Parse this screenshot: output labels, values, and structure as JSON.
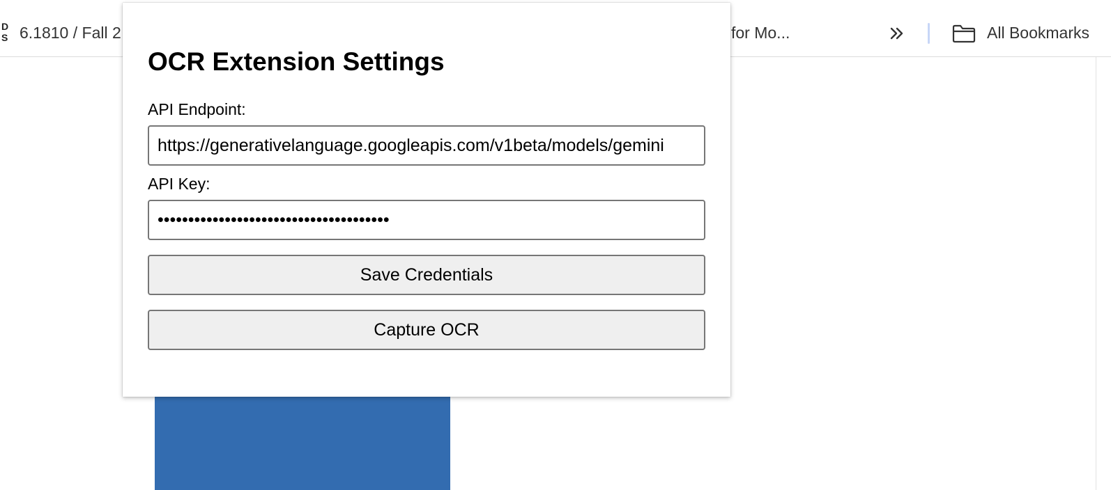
{
  "bookmarks_bar": {
    "favicon_letters": [
      "D",
      "S"
    ],
    "bookmark_1_label": "6.1810 / Fall 2",
    "bookmark_2_label": "for Mo...",
    "overflow_icon": "double-chevron-right-icon",
    "folder_icon": "folder-icon",
    "all_bookmarks_label": "All Bookmarks",
    "accent_color": "#c7d6f7"
  },
  "page": {
    "block_color": "#336cb0"
  },
  "popup": {
    "title": "OCR Extension Settings",
    "endpoint_label": "API Endpoint:",
    "endpoint_value": "https://generativelanguage.googleapis.com/v1beta/models/gemini",
    "key_label": "API Key:",
    "key_value": "••••••••••••••••••••••••••••••••••••••",
    "save_button_label": "Save Credentials",
    "capture_button_label": "Capture OCR"
  }
}
